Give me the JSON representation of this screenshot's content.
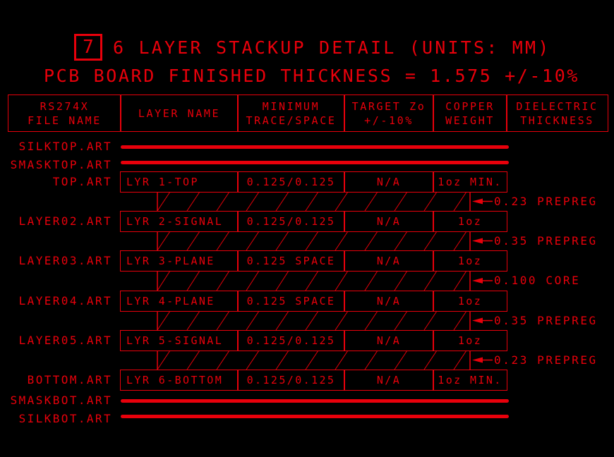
{
  "title": {
    "detail_number": "7",
    "line1": "6 LAYER STACKUP DETAIL (UNITS: MM)",
    "line2": "PCB BOARD FINISHED THICKNESS = 1.575 +/-10%"
  },
  "colors": {
    "drawing": "#e8000b",
    "background": "#000000"
  },
  "table": {
    "headers": {
      "file_name": "RS274X\nFILE NAME",
      "layer_name": "LAYER NAME",
      "trace_space": "MINIMUM\nTRACE/SPACE",
      "target_zo": "TARGET Zo\n+/-10%",
      "copper_weight": "COPPER\nWEIGHT",
      "dielectric": "DIELECTRIC\nTHICKNESS"
    },
    "top_masks": [
      "SILKTOP.ART",
      "SMASKTOP.ART"
    ],
    "layers": [
      {
        "file": "TOP.ART",
        "name": "LYR 1-TOP",
        "trace_space": "0.125/0.125",
        "target_zo": "N/A",
        "copper": "1oz MIN."
      },
      {
        "file": "LAYER02.ART",
        "name": "LYR 2-SIGNAL",
        "trace_space": "0.125/0.125",
        "target_zo": "N/A",
        "copper": "1oz"
      },
      {
        "file": "LAYER03.ART",
        "name": "LYR 3-PLANE",
        "trace_space": "0.125 SPACE",
        "target_zo": "N/A",
        "copper": "1oz"
      },
      {
        "file": "LAYER04.ART",
        "name": "LYR 4-PLANE",
        "trace_space": "0.125 SPACE",
        "target_zo": "N/A",
        "copper": "1oz"
      },
      {
        "file": "LAYER05.ART",
        "name": "LYR 5-SIGNAL",
        "trace_space": "0.125/0.125",
        "target_zo": "N/A",
        "copper": "1oz"
      },
      {
        "file": "BOTTOM.ART",
        "name": "LYR 6-BOTTOM",
        "trace_space": "0.125/0.125",
        "target_zo": "N/A",
        "copper": "1oz MIN."
      }
    ],
    "dielectrics": [
      {
        "label": "0.23 PREPREG"
      },
      {
        "label": "0.35 PREPREG"
      },
      {
        "label": "0.100 CORE"
      },
      {
        "label": "0.35 PREPREG"
      },
      {
        "label": "0.23 PREPREG"
      }
    ],
    "bottom_masks": [
      "SMASKBOT.ART",
      "SILKBOT.ART"
    ]
  }
}
